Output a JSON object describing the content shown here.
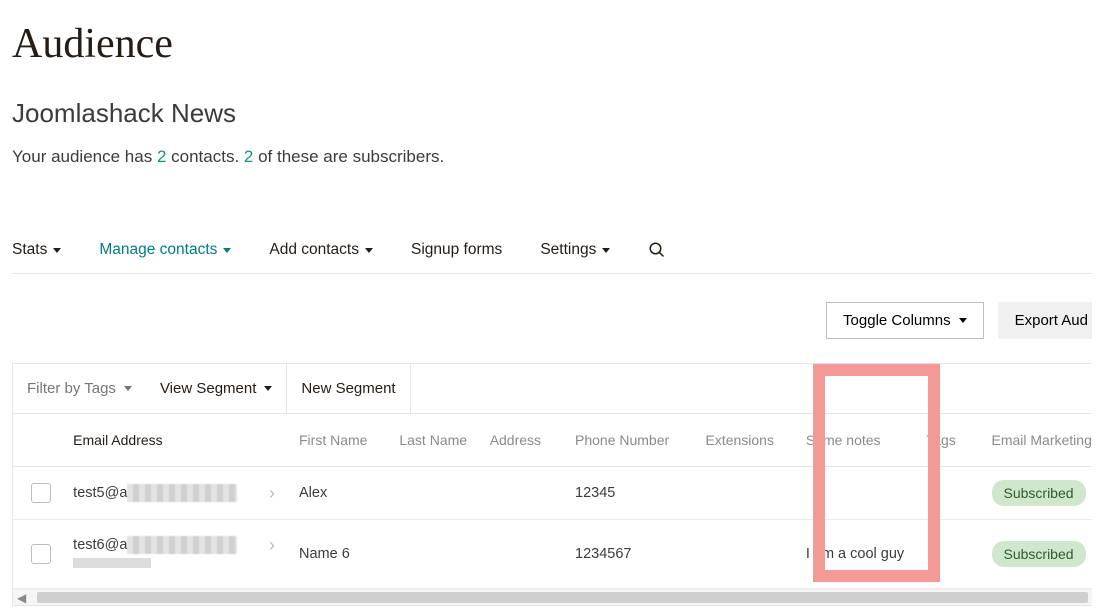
{
  "title": "Audience",
  "audience_name": "Joomlashack News",
  "summary_prefix": "Your audience has ",
  "contacts_count": "2",
  "summary_mid": " contacts. ",
  "subs_count": "2",
  "summary_suffix": " of these are subscribers.",
  "nav": {
    "stats": "Stats",
    "manage": "Manage contacts",
    "add": "Add contacts",
    "signup": "Signup forms",
    "settings": "Settings"
  },
  "actions": {
    "toggle": "Toggle Columns",
    "export": "Export Aud"
  },
  "filters": {
    "tags": "Filter by Tags",
    "segment": "View Segment",
    "new_segment": "New Segment"
  },
  "columns": {
    "email": "Email Address",
    "first_name": "First Name",
    "last_name": "Last Name",
    "address": "Address",
    "phone": "Phone Number",
    "extensions": "Extensions",
    "notes": "Some notes",
    "tags": "Tags",
    "email_marketing": "Email Marketing"
  },
  "rows": [
    {
      "email_prefix": "test5@a",
      "first_name": "Alex",
      "last_name": "",
      "address": "",
      "phone": "12345",
      "extensions": "",
      "notes": "",
      "tags": "",
      "status": "Subscribed"
    },
    {
      "email_prefix": "test6@a",
      "first_name": "Name 6",
      "last_name": "",
      "address": "",
      "phone": "1234567",
      "extensions": "",
      "notes": "I am a cool guy",
      "tags": "",
      "status": "Subscribed"
    }
  ]
}
